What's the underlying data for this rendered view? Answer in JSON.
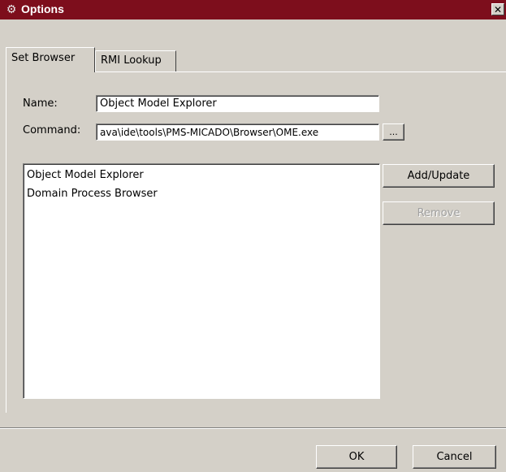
{
  "window": {
    "title": "Options",
    "icon": "gear-icon",
    "close_label": "✕"
  },
  "tabs": [
    {
      "label": "Set Browser",
      "active": true
    },
    {
      "label": "RMI Lookup",
      "active": false
    }
  ],
  "form": {
    "name_label": "Name:",
    "name_value": "Object Model Explorer",
    "command_label": "Command:",
    "command_value": "ava\\ide\\tools\\PMS-MICADO\\Browser\\OME.exe",
    "browse_label": "..."
  },
  "browsers": [
    "Object Model Explorer",
    "Domain Process Browser"
  ],
  "actions": {
    "add_update": "Add/Update",
    "remove": "Remove"
  },
  "footer": {
    "ok": "OK",
    "cancel": "Cancel"
  }
}
